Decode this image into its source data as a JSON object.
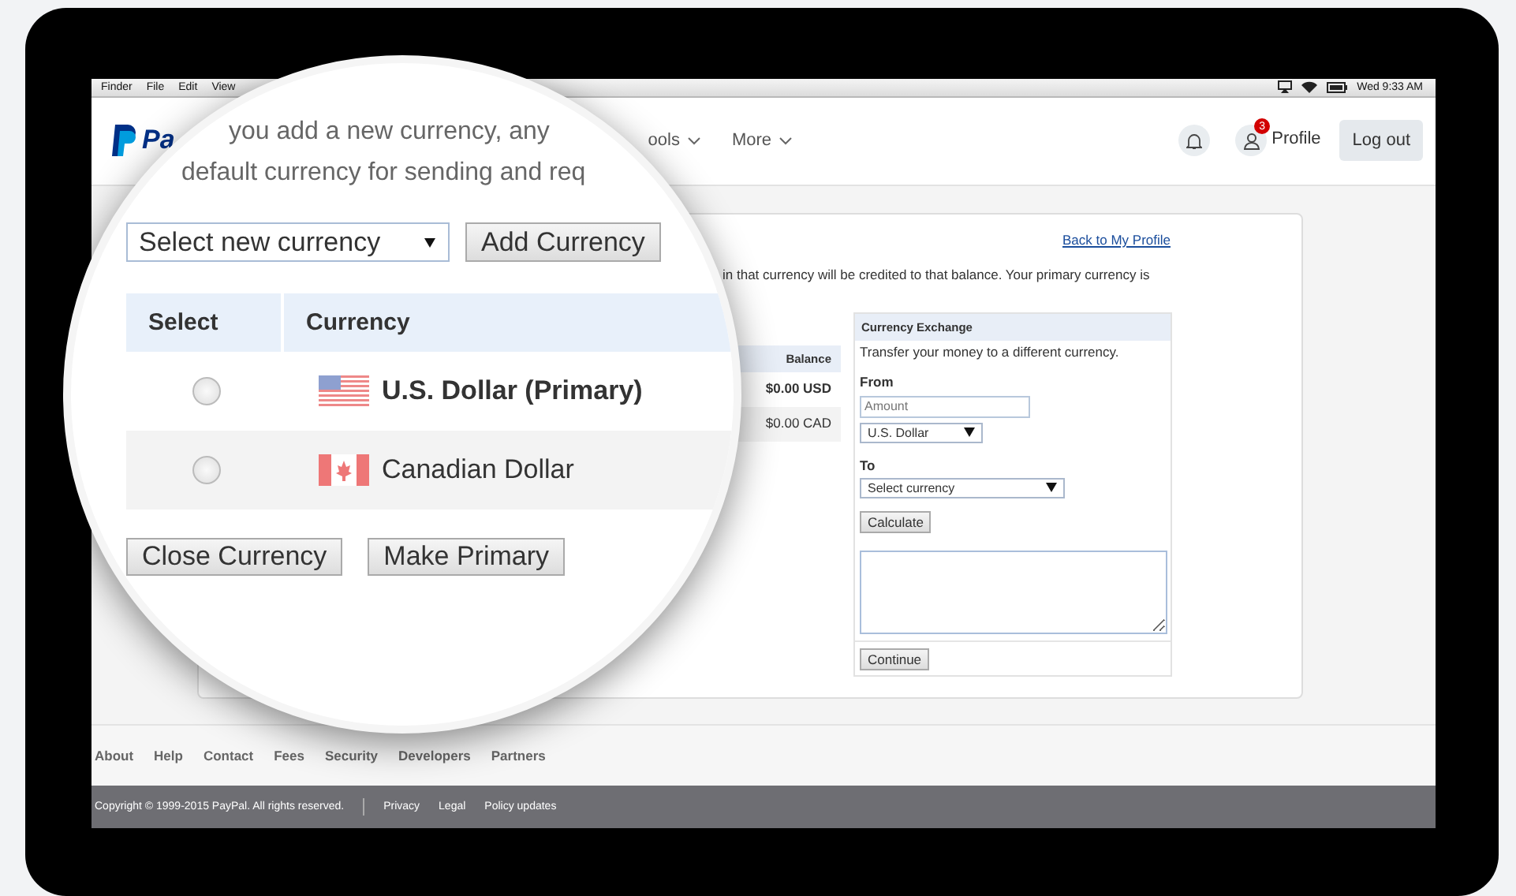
{
  "menu_bar": {
    "items": [
      "Finder",
      "File",
      "Edit",
      "View"
    ],
    "clock": "Wed 9:33 AM"
  },
  "nav": {
    "logo_text": "Pa",
    "items": [
      "ools",
      "More"
    ],
    "notification_count": "3",
    "profile_label": "Profile",
    "logout_label": "Log out"
  },
  "page": {
    "back_link": "Back to My Profile",
    "intro_text": "in that currency will be credited to that balance. Your primary currency is",
    "balance_table": {
      "column": "Balance",
      "rows": [
        {
          "balance": "$0.00 USD",
          "primary": true
        },
        {
          "balance": "$0.00 CAD",
          "primary": false
        }
      ]
    },
    "exchange": {
      "title": "Currency Exchange",
      "description": "Transfer your money to a different currency.",
      "from_label": "From",
      "amount_placeholder": "Amount",
      "from_currency": "U.S. Dollar",
      "to_label": "To",
      "to_currency": "Select currency",
      "calculate_label": "Calculate",
      "continue_label": "Continue"
    }
  },
  "magnifier": {
    "intro_lines": [
      "you add a new currency, any",
      "default currency for sending and req"
    ],
    "currency_select": "Select new currency",
    "add_button": "Add Currency",
    "columns": [
      "Select",
      "Currency"
    ],
    "rows": [
      {
        "kind": "us",
        "name": "U.S. Dollar (Primary)",
        "primary": true,
        "selected": false
      },
      {
        "kind": "ca",
        "name": "Canadian Dollar",
        "primary": false,
        "selected": false
      }
    ],
    "buttons": [
      "Close Currency",
      "Make Primary"
    ]
  },
  "footer": {
    "links": [
      "About",
      "Help",
      "Contact",
      "Fees",
      "Security",
      "Developers",
      "Partners"
    ],
    "copyright": "Copyright © 1999-2015 PayPal. All rights reserved.",
    "legal_links": [
      "Privacy",
      "Legal",
      "Policy updates"
    ]
  }
}
